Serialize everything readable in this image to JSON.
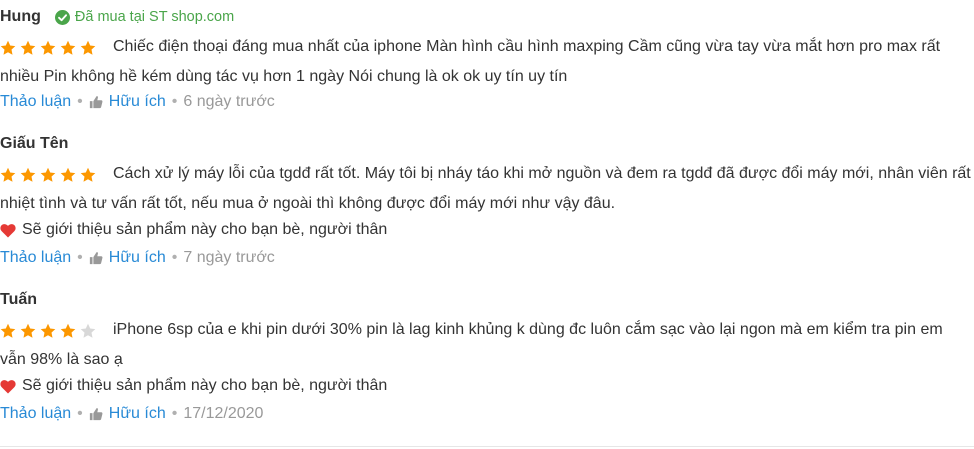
{
  "colors": {
    "star_filled": "#fc9700",
    "star_empty": "#d8d8d8",
    "link": "#288ad6",
    "verified": "#4aa54a",
    "heart": "#e53935",
    "muted": "#999999"
  },
  "reviews": [
    {
      "author": "Hung",
      "verified_label": "Đã mua tại ST shop.com",
      "rating": 5,
      "rating_max": 5,
      "text": "Chiếc điện thoại đáng mua nhất của iphone Màn hình cầu hình maxping Cầm cũng vừa tay vừa mắt hơn pro max rất nhiều Pin không hề kém dùng tác vụ hơn 1 ngày Nói chung là ok ok uy tín uy tín",
      "recommend": "",
      "discuss_label": "Thảo luận",
      "helpful_label": "Hữu ích",
      "time": "6 ngày trước"
    },
    {
      "author": "Giấu Tên",
      "verified_label": "",
      "rating": 5,
      "rating_max": 5,
      "text": "Cách xử lý máy lỗi của tgdđ rất tốt. Máy tôi bị nháy táo khi mở nguồn và đem ra tgdđ đã được đổi máy mới, nhân viên rất nhiệt tình và tư vấn rất tốt, nếu mua ở ngoài thì không được đổi máy mới như vậy đâu.",
      "recommend": "Sẽ giới thiệu sản phẩm này cho bạn bè, người thân",
      "discuss_label": "Thảo luận",
      "helpful_label": "Hữu ích",
      "time": "7 ngày trước"
    },
    {
      "author": "Tuấn",
      "verified_label": "",
      "rating": 4,
      "rating_max": 5,
      "text": "iPhone 6sp của e khi pin dưới 30% pin là lag kinh khủng k dùng đc luôn cắm sạc vào lại ngon mà em kiểm tra pin em vẫn 98% là sao ạ",
      "recommend": "Sẽ giới thiệu sản phẩm này cho bạn bè, người thân",
      "discuss_label": "Thảo luận",
      "helpful_label": "Hữu ích",
      "time": "17/12/2020"
    }
  ]
}
